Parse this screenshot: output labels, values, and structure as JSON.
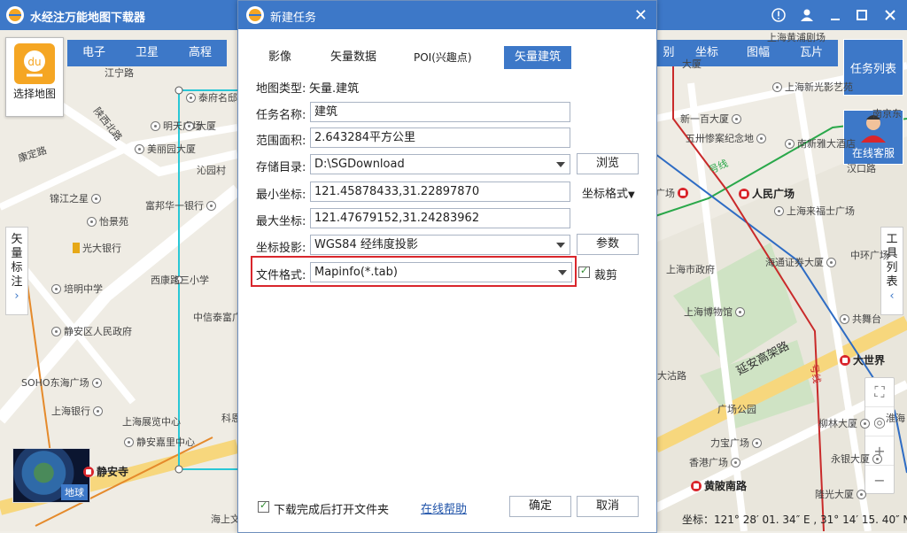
{
  "app": {
    "title": "水经注万能地图下载器"
  },
  "map": {
    "toolbar_left": [
      "电子",
      "卫星",
      "高程"
    ],
    "toolbar_right": [
      "别",
      "坐标",
      "图幅",
      "瓦片"
    ],
    "select_map_label": "选择地图",
    "left_tab_text": [
      "矢",
      "量",
      "标",
      "注"
    ],
    "right_tab_text": [
      "工",
      "具",
      "列",
      "表"
    ],
    "task_list_label": "任务列表",
    "service_label": "在线客服",
    "globe_label": "地球",
    "coord_status": "坐标：121° 28′ 01. 34″ E , 31° 14′ 15. 40″ N",
    "pois": [
      {
        "text": "江宁路"
      },
      {
        "text": "泰府名邸"
      },
      {
        "text": "大厦"
      },
      {
        "text": "明天广场"
      },
      {
        "text": "美丽园大厦"
      },
      {
        "text": "沁园村"
      },
      {
        "text": "锦江之星"
      },
      {
        "text": "富邦华一银行"
      },
      {
        "text": "怡景苑"
      },
      {
        "text": "光大银行"
      },
      {
        "text": "培明中学"
      },
      {
        "text": "西康路三小学"
      },
      {
        "text": "中信泰富广"
      },
      {
        "text": "静安区人民政府"
      },
      {
        "text": "SOHO东海广场"
      },
      {
        "text": "上海银行"
      },
      {
        "text": "上海展览中心"
      },
      {
        "text": "静安嘉里中心"
      },
      {
        "text": "静安寺"
      },
      {
        "text": "科恩"
      },
      {
        "text": "海上文"
      },
      {
        "text": "上海黄浦剧场"
      },
      {
        "text": "大厦"
      },
      {
        "text": "上海新光影艺苑"
      },
      {
        "text": "新一百大厦"
      },
      {
        "text": "五卅惨案纪念地"
      },
      {
        "text": "南新雅大酒店"
      },
      {
        "text": "汉口路"
      },
      {
        "text": "人民广场"
      },
      {
        "text": "上海来福士广场"
      },
      {
        "text": "海通证券大厦"
      },
      {
        "text": "中环广场"
      },
      {
        "text": "上海市政府"
      },
      {
        "text": "共舞台"
      },
      {
        "text": "上海博物馆"
      },
      {
        "text": "大世界"
      },
      {
        "text": "延安高架路"
      },
      {
        "text": "广场公园"
      },
      {
        "text": "柳林大厦"
      },
      {
        "text": "力宝广场"
      },
      {
        "text": "香港广场"
      },
      {
        "text": "永银大厦"
      },
      {
        "text": "黄陂南路"
      },
      {
        "text": "隆光大厦"
      },
      {
        "text": "康定路"
      },
      {
        "text": "陕西北路"
      },
      {
        "text": "南京东"
      },
      {
        "text": "广场"
      },
      {
        "text": "号线"
      },
      {
        "text": "淮海"
      },
      {
        "text": "号线"
      },
      {
        "text": "大沽路"
      }
    ]
  },
  "dialog": {
    "title": "新建任务",
    "tabs": [
      "影像",
      "矢量数据",
      "POI(兴趣点)",
      "矢量建筑"
    ],
    "active_tab": "矢量建筑",
    "map_type_label": "地图类型:",
    "map_type_value": "矢量.建筑",
    "task_name_label": "任务名称:",
    "task_name_value": "建筑",
    "area_label": "范围面积:",
    "area_value": "2.643284平方公里",
    "save_dir_label": "存储目录:",
    "save_dir_value": "D:\\SGDownload",
    "browse_label": "浏览",
    "min_coord_label": "最小坐标:",
    "min_coord_value": "121.45878433,31.22897870",
    "coord_format_label": "坐标格式",
    "max_coord_label": "最大坐标:",
    "max_coord_value": "121.47679152,31.24283962",
    "projection_label": "坐标投影:",
    "projection_value": "WGS84 经纬度投影",
    "params_label": "参数",
    "file_format_label": "文件格式:",
    "file_format_value": "Mapinfo(*.tab)",
    "clip_label": "裁剪",
    "open_folder_label": "下载完成后打开文件夹",
    "help_label": "在线帮助",
    "ok_label": "确定",
    "cancel_label": "取消"
  },
  "colors": {
    "brand_blue": "#3d78c8",
    "highlight_red": "#d9262c",
    "arrow_red": "#e03a3a"
  }
}
